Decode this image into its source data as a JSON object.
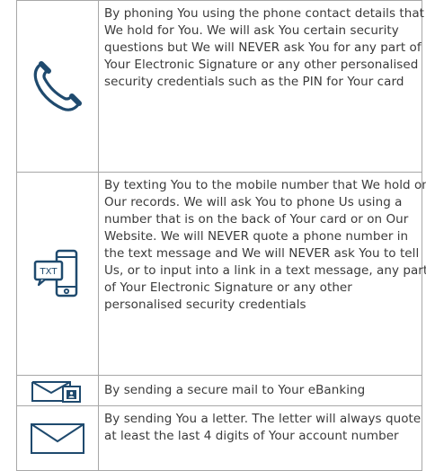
{
  "rows": [
    {
      "icon": "phone-handset-icon",
      "text": "By phoning You using the phone contact details that We hold for You. We will ask You certain security questions but We will NEVER ask You for any part of Your Electronic Signature or any other personalised security credentials such as the PIN for Your card"
    },
    {
      "icon": "mobile-txt-icon",
      "icon_label": "TXT",
      "text": "By texting You to the mobile number that We hold on Our records. We will ask You to phone Us using a number that is on the back of Your card or on Our Website. We will NEVER quote a phone number in the text message and We will NEVER ask You to tell Us, or to input into a link in a text message, any part of Your Electronic Signature or any other personalised security credentials"
    },
    {
      "icon": "secure-mail-icon",
      "text": "By sending a secure mail to Your eBanking"
    },
    {
      "icon": "envelope-icon",
      "text": "By sending You a letter. The letter will always quote at least the last 4 digits of Your account number"
    }
  ],
  "colors": {
    "icon_stroke": "#1f4a6e",
    "border": "#a7a7a7",
    "text": "#3a3a3a"
  }
}
